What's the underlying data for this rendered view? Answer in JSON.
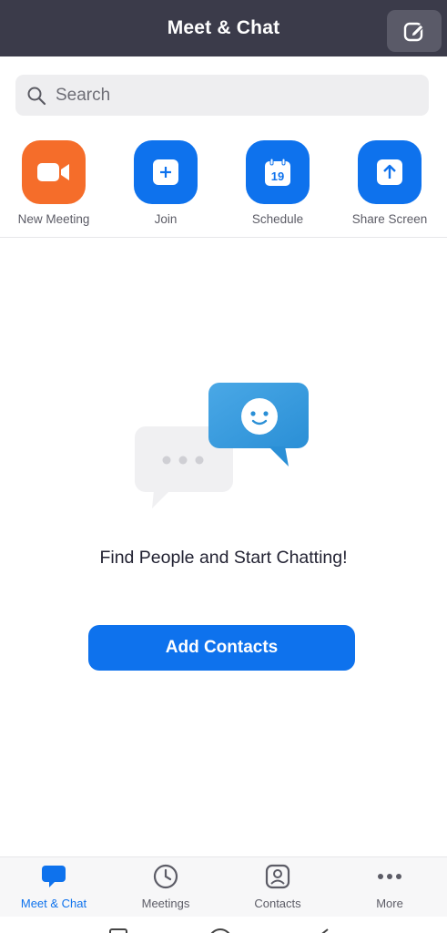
{
  "header": {
    "title": "Meet & Chat",
    "compose_icon": "compose-icon"
  },
  "search": {
    "placeholder": "Search",
    "icon": "search-icon"
  },
  "actions": [
    {
      "label": "New Meeting",
      "icon": "video-camera-icon",
      "color": "#f56d2a"
    },
    {
      "label": "Join",
      "icon": "plus-icon",
      "color": "#0e72ed"
    },
    {
      "label": "Schedule",
      "icon": "calendar-icon",
      "color": "#0e72ed",
      "calendar_day": "19"
    },
    {
      "label": "Share Screen",
      "icon": "upload-arrow-icon",
      "color": "#0e72ed"
    }
  ],
  "empty_state": {
    "message": "Find People and Start Chatting!",
    "button_label": "Add Contacts"
  },
  "bottom_nav": {
    "items": [
      {
        "label": "Meet & Chat",
        "icon": "chat-bubble-icon",
        "active": true
      },
      {
        "label": "Meetings",
        "icon": "clock-icon",
        "active": false
      },
      {
        "label": "Contacts",
        "icon": "contact-card-icon",
        "active": false
      },
      {
        "label": "More",
        "icon": "more-dots-icon",
        "active": false
      }
    ]
  },
  "colors": {
    "header_bg": "#3b3b4a",
    "accent_blue": "#0e72ed",
    "accent_orange": "#f56d2a"
  }
}
